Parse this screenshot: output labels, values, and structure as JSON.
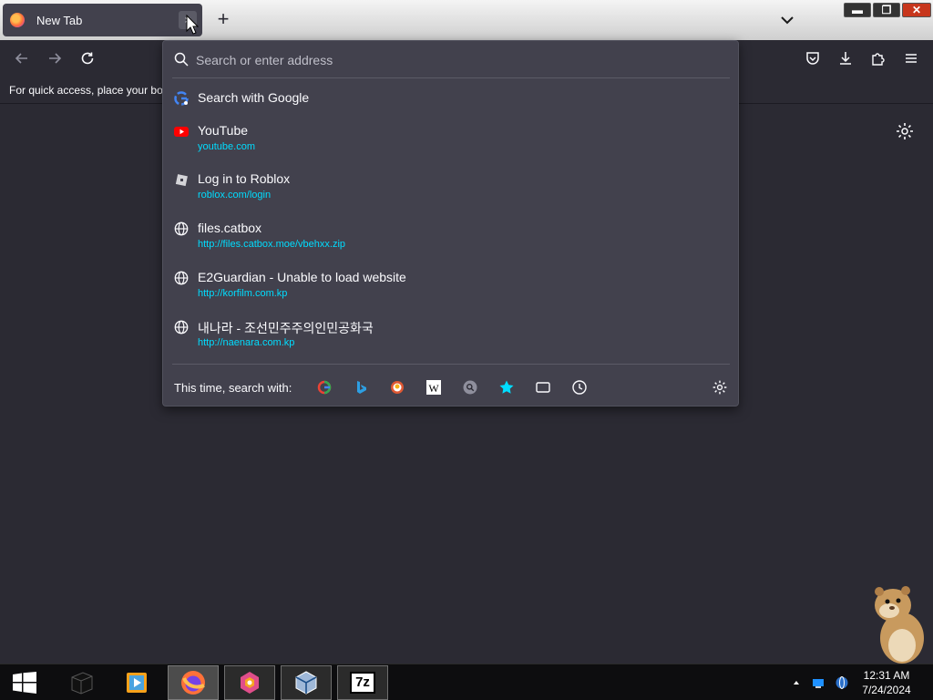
{
  "tabs": [
    {
      "title": "New Tab"
    }
  ],
  "tab_close_label": "×",
  "new_tab_label": "+",
  "window_controls": {
    "minimize": "▬",
    "restore": "❐",
    "close": "✕"
  },
  "bookmarks_bar": {
    "text": "For quick access, place your boo"
  },
  "urlbar": {
    "placeholder": "Search or enter address",
    "results": [
      {
        "title": "Search with Google",
        "url": "",
        "icon": "google-icon"
      },
      {
        "title": "YouTube",
        "url": "youtube.com",
        "icon": "youtube-icon"
      },
      {
        "title": "Log in to Roblox",
        "url": "roblox.com/login",
        "icon": "roblox-icon"
      },
      {
        "title": "files.catbox",
        "url": "http://files.catbox.moe/vbehxx.zip",
        "icon": "globe-icon"
      },
      {
        "title": "E2Guardian - Unable to load website",
        "url": "http://korfilm.com.kp",
        "icon": "globe-icon"
      },
      {
        "title": "내나라 - 조선민주주의인민공화국",
        "url": "http://naenara.com.kp",
        "icon": "globe-icon"
      }
    ],
    "search_with_label": "This time, search with:",
    "engines": [
      "google-icon",
      "bing-icon",
      "duckduckgo-icon",
      "wikipedia-icon",
      "search-engine-icon",
      "bookmarks-star-icon",
      "tabs-icon",
      "history-icon"
    ]
  },
  "taskbar": {
    "clock_time": "12:31 AM",
    "clock_date": "7/24/2024",
    "seven_zip_label": "7z"
  },
  "colors": {
    "toolbar": "#2b2a33",
    "dropdown": "#42414d",
    "link": "#00ddff",
    "accent_star": "#00ddff"
  }
}
